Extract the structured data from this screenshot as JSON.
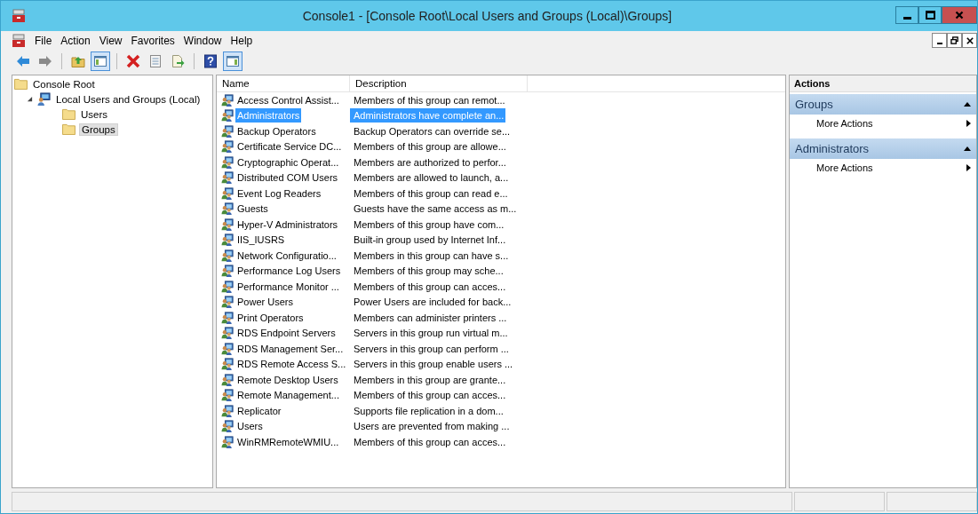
{
  "window": {
    "title": "Console1 - [Console Root\\Local Users and Groups (Local)\\Groups]"
  },
  "menu": [
    "File",
    "Action",
    "View",
    "Favorites",
    "Window",
    "Help"
  ],
  "toolbar": [
    [
      {
        "kind": "back",
        "pressed": false
      },
      {
        "kind": "forward",
        "pressed": false
      }
    ],
    [
      {
        "kind": "up",
        "pressed": false
      },
      {
        "kind": "tree",
        "pressed": true
      }
    ],
    [
      {
        "kind": "delete",
        "pressed": false
      },
      {
        "kind": "properties",
        "pressed": false
      },
      {
        "kind": "export",
        "pressed": false
      }
    ],
    [
      {
        "kind": "help",
        "pressed": false
      },
      {
        "kind": "pane",
        "pressed": true
      }
    ]
  ],
  "tree": [
    {
      "label": "Console Root",
      "kind": "folder",
      "selected": false,
      "children": [
        {
          "label": "Local Users and Groups (Local)",
          "kind": "computer",
          "selected": false,
          "expanded": true,
          "children": [
            {
              "label": "Users",
              "kind": "folder",
              "selected": false
            },
            {
              "label": "Groups",
              "kind": "folder",
              "selected": true
            }
          ]
        }
      ]
    }
  ],
  "table": {
    "columns": [
      "Name",
      "Description"
    ],
    "rows": [
      {
        "name": "Access Control Assist...",
        "description": "Members of this group can remot...",
        "selected": false
      },
      {
        "name": "Administrators",
        "description": "Administrators have complete an...",
        "selected": true
      },
      {
        "name": "Backup Operators",
        "description": "Backup Operators can override se...",
        "selected": false
      },
      {
        "name": "Certificate Service DC...",
        "description": "Members of this group are allowe...",
        "selected": false
      },
      {
        "name": "Cryptographic Operat...",
        "description": "Members are authorized to perfor...",
        "selected": false
      },
      {
        "name": "Distributed COM Users",
        "description": "Members are allowed to launch, a...",
        "selected": false
      },
      {
        "name": "Event Log Readers",
        "description": "Members of this group can read e...",
        "selected": false
      },
      {
        "name": "Guests",
        "description": "Guests have the same access as m...",
        "selected": false
      },
      {
        "name": "Hyper-V Administrators",
        "description": "Members of this group have com...",
        "selected": false
      },
      {
        "name": "IIS_IUSRS",
        "description": "Built-in group used by Internet Inf...",
        "selected": false
      },
      {
        "name": "Network Configuratio...",
        "description": "Members in this group can have s...",
        "selected": false
      },
      {
        "name": "Performance Log Users",
        "description": "Members of this group may sche...",
        "selected": false
      },
      {
        "name": "Performance Monitor ...",
        "description": "Members of this group can acces...",
        "selected": false
      },
      {
        "name": "Power Users",
        "description": "Power Users are included for back...",
        "selected": false
      },
      {
        "name": "Print Operators",
        "description": "Members can administer printers ...",
        "selected": false
      },
      {
        "name": "RDS Endpoint Servers",
        "description": "Servers in this group run virtual m...",
        "selected": false
      },
      {
        "name": "RDS Management Ser...",
        "description": "Servers in this group can perform ...",
        "selected": false
      },
      {
        "name": "RDS Remote Access S...",
        "description": "Servers in this group enable users ...",
        "selected": false
      },
      {
        "name": "Remote Desktop Users",
        "description": "Members in this group are grante...",
        "selected": false
      },
      {
        "name": "Remote Management...",
        "description": "Members of this group can acces...",
        "selected": false
      },
      {
        "name": "Replicator",
        "description": "Supports file replication in a dom...",
        "selected": false
      },
      {
        "name": "Users",
        "description": "Users are prevented from making ...",
        "selected": false
      },
      {
        "name": "WinRMRemoteWMIU...",
        "description": "Members of this group can acces...",
        "selected": false
      }
    ]
  },
  "actions": {
    "title": "Actions",
    "sections": [
      {
        "title": "Groups",
        "expanded": true,
        "items": [
          "More Actions"
        ]
      },
      {
        "title": "Administrators",
        "expanded": true,
        "items": [
          "More Actions"
        ]
      }
    ]
  }
}
